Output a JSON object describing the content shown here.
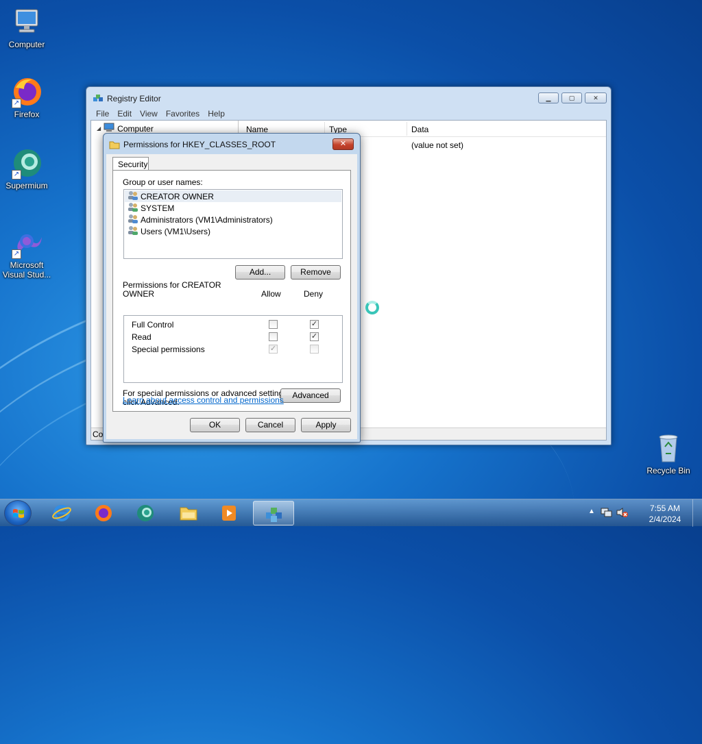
{
  "desktop": {
    "icons": [
      {
        "label": "Computer",
        "icon": "computer-icon"
      },
      {
        "label": "Firefox",
        "icon": "firefox-icon"
      },
      {
        "label": "Supermium",
        "icon": "supermium-icon"
      },
      {
        "label": "Microsoft Visual Stud...",
        "icon": "visual-studio-icon"
      },
      {
        "label": "Recycle Bin",
        "icon": "recycle-bin-icon"
      }
    ]
  },
  "regedit": {
    "title": "Registry Editor",
    "menu": [
      "File",
      "Edit",
      "View",
      "Favorites",
      "Help"
    ],
    "tree_root": "Computer",
    "columns": [
      "Name",
      "Type",
      "Data"
    ],
    "rows": [
      {
        "data": "(value not set)"
      }
    ],
    "status": "Co"
  },
  "permissions_dialog": {
    "title": "Permissions for HKEY_CLASSES_ROOT",
    "tab": "Security",
    "group_label": "Group or user names:",
    "users": [
      {
        "name": "CREATOR OWNER",
        "selected": true
      },
      {
        "name": "SYSTEM",
        "selected": false
      },
      {
        "name": "Administrators (VM1\\Administrators)",
        "selected": false
      },
      {
        "name": "Users (VM1\\Users)",
        "selected": false
      }
    ],
    "add_button": "Add...",
    "remove_button": "Remove",
    "permissions_for_line1": "Permissions for CREATOR",
    "permissions_for_line2": "OWNER",
    "allow_header": "Allow",
    "deny_header": "Deny",
    "permissions": [
      {
        "name": "Full Control",
        "allow": false,
        "deny": true
      },
      {
        "name": "Read",
        "allow": false,
        "deny": true
      },
      {
        "name": "Special permissions",
        "allow": true,
        "deny": false
      }
    ],
    "special_text_line1": "For special permissions or advanced settings,",
    "special_text_line2": "click Advanced.",
    "advanced_button": "Advanced",
    "learn_link": "Learn about access control and permissions",
    "ok_button": "OK",
    "cancel_button": "Cancel",
    "apply_button": "Apply",
    "close_glyph": "✕"
  },
  "taskbar": {
    "items": [
      "internet-explorer-icon",
      "firefox-icon",
      "supermium-icon",
      "file-explorer-icon",
      "media-player-icon",
      "registry-editor-icon"
    ],
    "time": "7:55 AM",
    "date": "2/4/2024"
  }
}
